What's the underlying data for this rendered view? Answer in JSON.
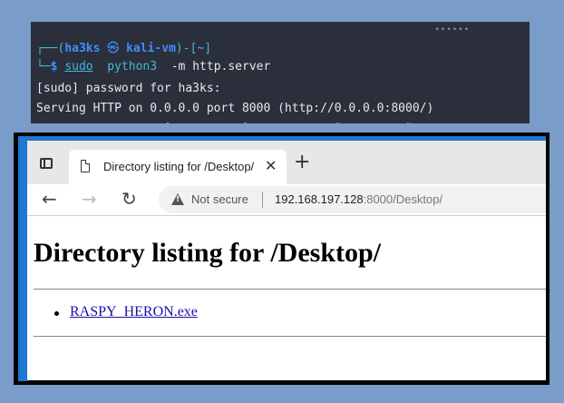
{
  "terminal": {
    "prompt_open": "┌──(",
    "user": "ha3ks",
    "skull": "㉿",
    "host": "kali-vm",
    "prompt_mid": ")-[",
    "cwd": "~",
    "prompt_close": "]",
    "prompt_arrow": "└─",
    "dollar": "$",
    "cmd_sudo": "sudo",
    "cmd_python": "python3",
    "cmd_flag": "-m",
    "cmd_arg": "http.server",
    "output_line1": "[sudo] password for ha3ks:",
    "output_line2": "Serving HTTP on 0.0.0.0 port 8000 (http://0.0.0.0:8000/)",
    "output_line3_partial": "                  [          ]            \"         \"   "
  },
  "browser": {
    "tab_title": "Directory listing for /Desktop/",
    "tab_close": "✕",
    "new_tab": "+",
    "back": "←",
    "forward": "→",
    "reload": "↻",
    "security_label": "Not secure",
    "url_host": "192.168.197.128",
    "url_rest": ":8000/Desktop/"
  },
  "page": {
    "heading": "Directory listing for /Desktop/",
    "files": [
      "RASPY_HERON.exe"
    ]
  },
  "colors": {
    "background": "#7a9cc8",
    "terminal_bg": "#2b2f3b",
    "prompt_blue": "#3f8fff",
    "command_cyan": "#41b9d8",
    "frame_accent": "#1f78d1",
    "link": "#1a0dab"
  }
}
